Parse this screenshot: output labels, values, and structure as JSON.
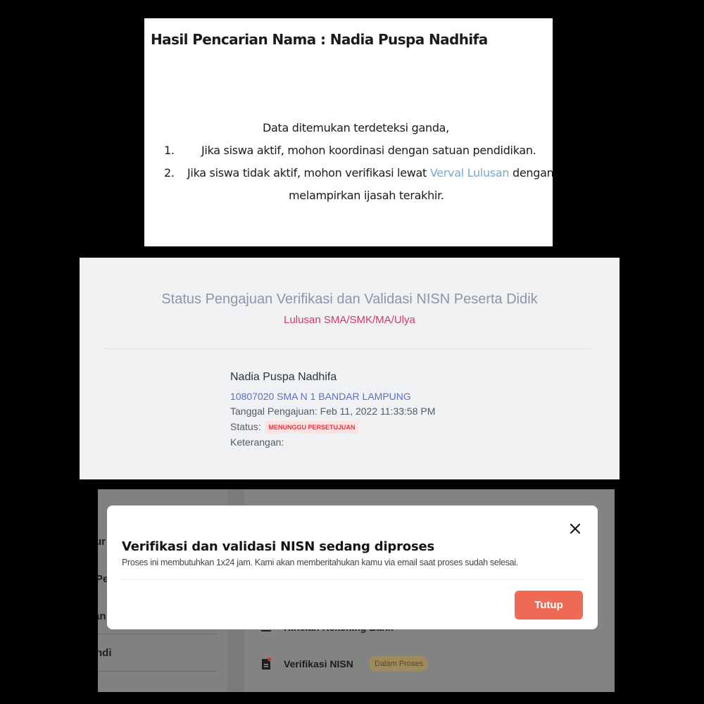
{
  "search_result": {
    "title": "Hasil Pencarian Nama : Nadia Puspa Nadhifa",
    "intro": "Data ditemukan terdeteksi ganda,",
    "item1_number": "1.",
    "item1_text": "Jika siswa aktif, mohon koordinasi dengan satuan pendidikan.",
    "item2_number": "2.",
    "item2_text_before": "Jika siswa tidak aktif, mohon verifikasi lewat",
    "item2_link": "Verval Lulusan",
    "item2_text_after": "dengan",
    "item2_line2": "melampirkan ijasah terakhir.",
    "link_color": "#7ba8c9"
  },
  "status_page": {
    "title": "Status Pengajuan Verifikasi dan Validasi NISN Peserta Didik",
    "subtitle": "Lulusan SMA/SMK/MA/Ulya",
    "student_name": "Nadia Puspa Nadhifa",
    "school": "10807020 SMA N 1 BANDAR LAMPUNG",
    "submission_date": "Tanggal Pengajuan: Feb 11, 2022 11:33:58 PM",
    "status_label": "Status:",
    "status_badge": "MENUNGGU PERSETUJUAN",
    "note_label": "Keterangan:",
    "subtitle_color": "#d33a62",
    "badge_color": "#e0343b"
  },
  "app_background": {
    "sidebar_items": [
      "ur",
      "Pe",
      "an",
      "ndi"
    ],
    "bank_item": "Rincian Rekening Bank",
    "bank_icon": "bank-icon",
    "verification_item": "Verifikasi NISN",
    "verification_icon": "document-icon",
    "verification_chip": "Dalam Proses"
  },
  "modal": {
    "title": "Verifikasi dan validasi NISN sedang diproses",
    "description": "Proses ini membutuhkan 1x24 jam. Kami akan memberitahukan kamu via email saat proses sudah selesai.",
    "close_icon": "close-icon",
    "button_label": "Tutup",
    "button_color": "#ef6a55"
  }
}
